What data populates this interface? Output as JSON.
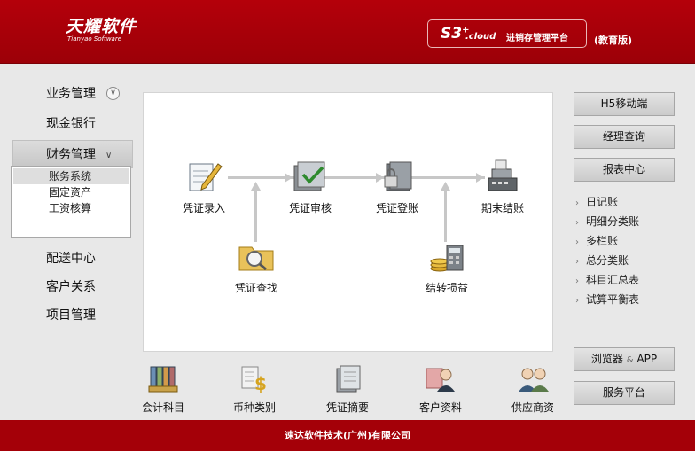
{
  "header": {
    "brand_cn": "天耀软件",
    "brand_en": "Tianyao Software",
    "product_s3": "S3",
    "product_plus": "+",
    "product_cloud": ".cloud",
    "product_name": "进销存管理平台",
    "edition": "(教育版)"
  },
  "sidebar": {
    "items": [
      {
        "label": "业务管理"
      },
      {
        "label": "现金银行"
      },
      {
        "label": "财务管理"
      }
    ],
    "sub_items": [
      {
        "label": "账务系统"
      },
      {
        "label": "固定资产"
      },
      {
        "label": "工资核算"
      }
    ],
    "items2": [
      {
        "label": "配送中心"
      },
      {
        "label": "客户关系"
      },
      {
        "label": "项目管理"
      }
    ]
  },
  "flow": {
    "voucher_entry": "凭证录入",
    "voucher_audit": "凭证审核",
    "voucher_post": "凭证登账",
    "period_close": "期末结账",
    "voucher_search": "凭证查找",
    "transfer_pl": "结转损益"
  },
  "shortcuts": [
    {
      "label": "会计科目"
    },
    {
      "label": "币种类别"
    },
    {
      "label": "凭证摘要"
    },
    {
      "label": "客户资料"
    },
    {
      "label": "供应商资"
    }
  ],
  "right": {
    "h5": "H5移动端",
    "manager": "经理查询",
    "report_center": "报表中心",
    "reports": [
      {
        "label": "日记账"
      },
      {
        "label": "明细分类账"
      },
      {
        "label": "多栏账"
      },
      {
        "label": "总分类账"
      },
      {
        "label": "科目汇总表"
      },
      {
        "label": "试算平衡表"
      }
    ],
    "browser_a": "浏览器",
    "browser_amp": "&",
    "browser_b": "APP",
    "service": "服务平台"
  },
  "footer": {
    "company": "速达软件技术(广州)有限公司"
  },
  "colors": {
    "header_red": "#b4000a",
    "footer_red": "#a40008"
  }
}
